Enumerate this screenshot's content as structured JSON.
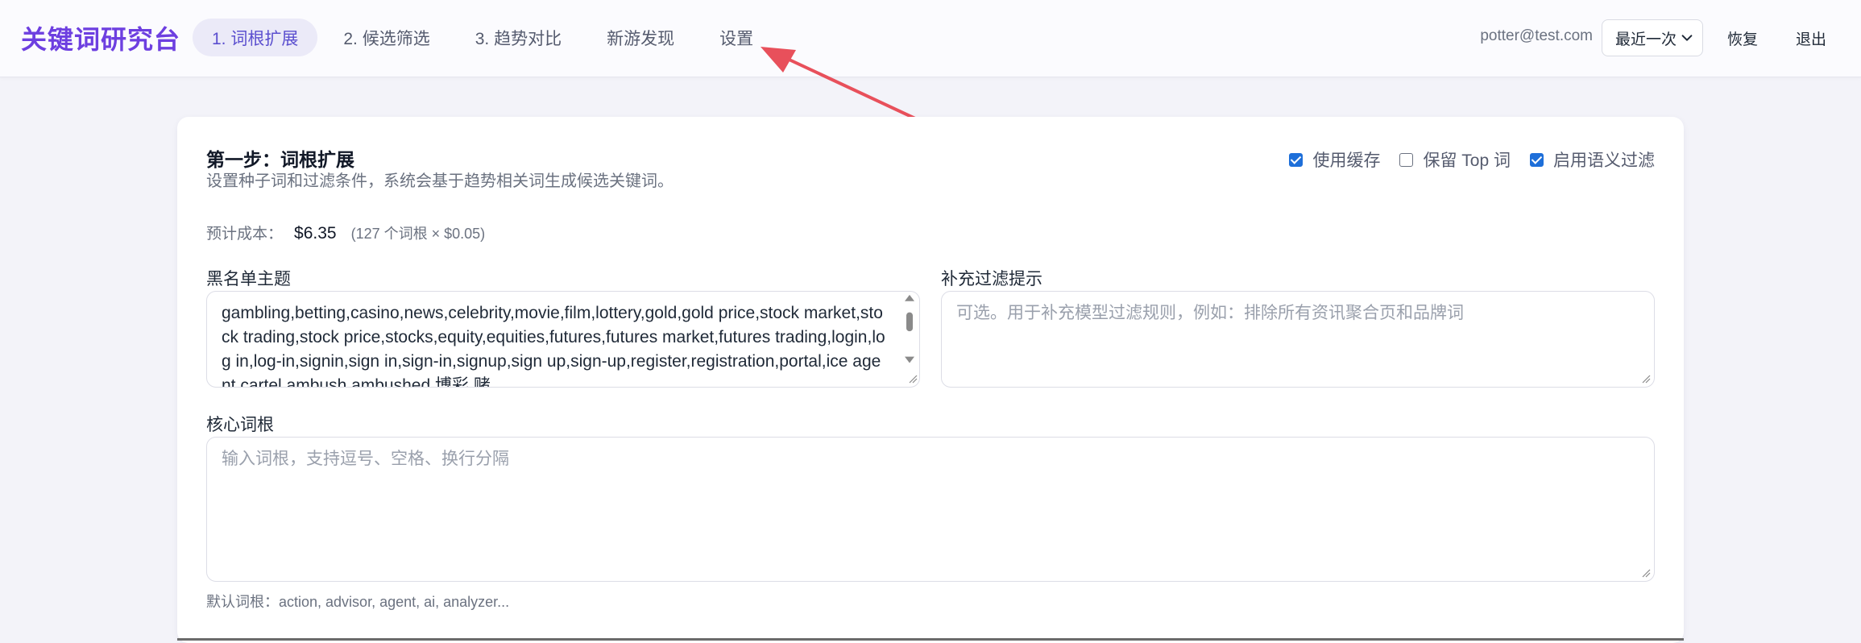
{
  "header": {
    "logo": "关键词研究台",
    "tabs": [
      {
        "label": "1. 词根扩展",
        "active": true
      },
      {
        "label": "2. 候选筛选",
        "active": false
      },
      {
        "label": "3. 趋势对比",
        "active": false
      },
      {
        "label": "新游发现",
        "active": false
      },
      {
        "label": "设置",
        "active": false
      }
    ],
    "user_email": "potter@test.com",
    "history_select": "最近一次",
    "restore_label": "恢复",
    "logout_label": "退出"
  },
  "card": {
    "title": "第一步：词根扩展",
    "description": "设置种子词和过滤条件，系统会基于趋势相关词生成候选关键词。",
    "options": [
      {
        "label": "使用缓存",
        "checked": true
      },
      {
        "label": "保留 Top 词",
        "checked": false
      },
      {
        "label": "启用语义过滤",
        "checked": true
      }
    ],
    "cost": {
      "label": "预计成本：",
      "value": "$6.35",
      "note": "(127 个词根 × $0.05)"
    },
    "blacklist": {
      "label": "黑名单主题",
      "value": "gambling,betting,casino,news,celebrity,movie,film,lottery,gold,gold price,stock market,stock trading,stock price,stocks,equity,equities,futures,futures market,futures trading,login,log in,log-in,signin,sign in,sign-in,signup,sign up,sign-up,register,registration,portal,ice agent,cartel,ambush,ambushed,博彩,赌"
    },
    "extra_filter": {
      "label": "补充过滤提示",
      "placeholder": "可选。用于补充模型过滤规则，例如：排除所有资讯聚合页和品牌词"
    },
    "core_roots": {
      "label": "核心词根",
      "placeholder": "输入词根，支持逗号、空格、换行分隔"
    },
    "default_roots_hint": "默认词根：action, advisor, agent, ai, analyzer..."
  },
  "colors": {
    "accent": "#6d3fe0",
    "tab_active_bg": "#ebeaf8",
    "checkbox_on": "#1e6fd9",
    "annotation_arrow": "#e8505b"
  }
}
